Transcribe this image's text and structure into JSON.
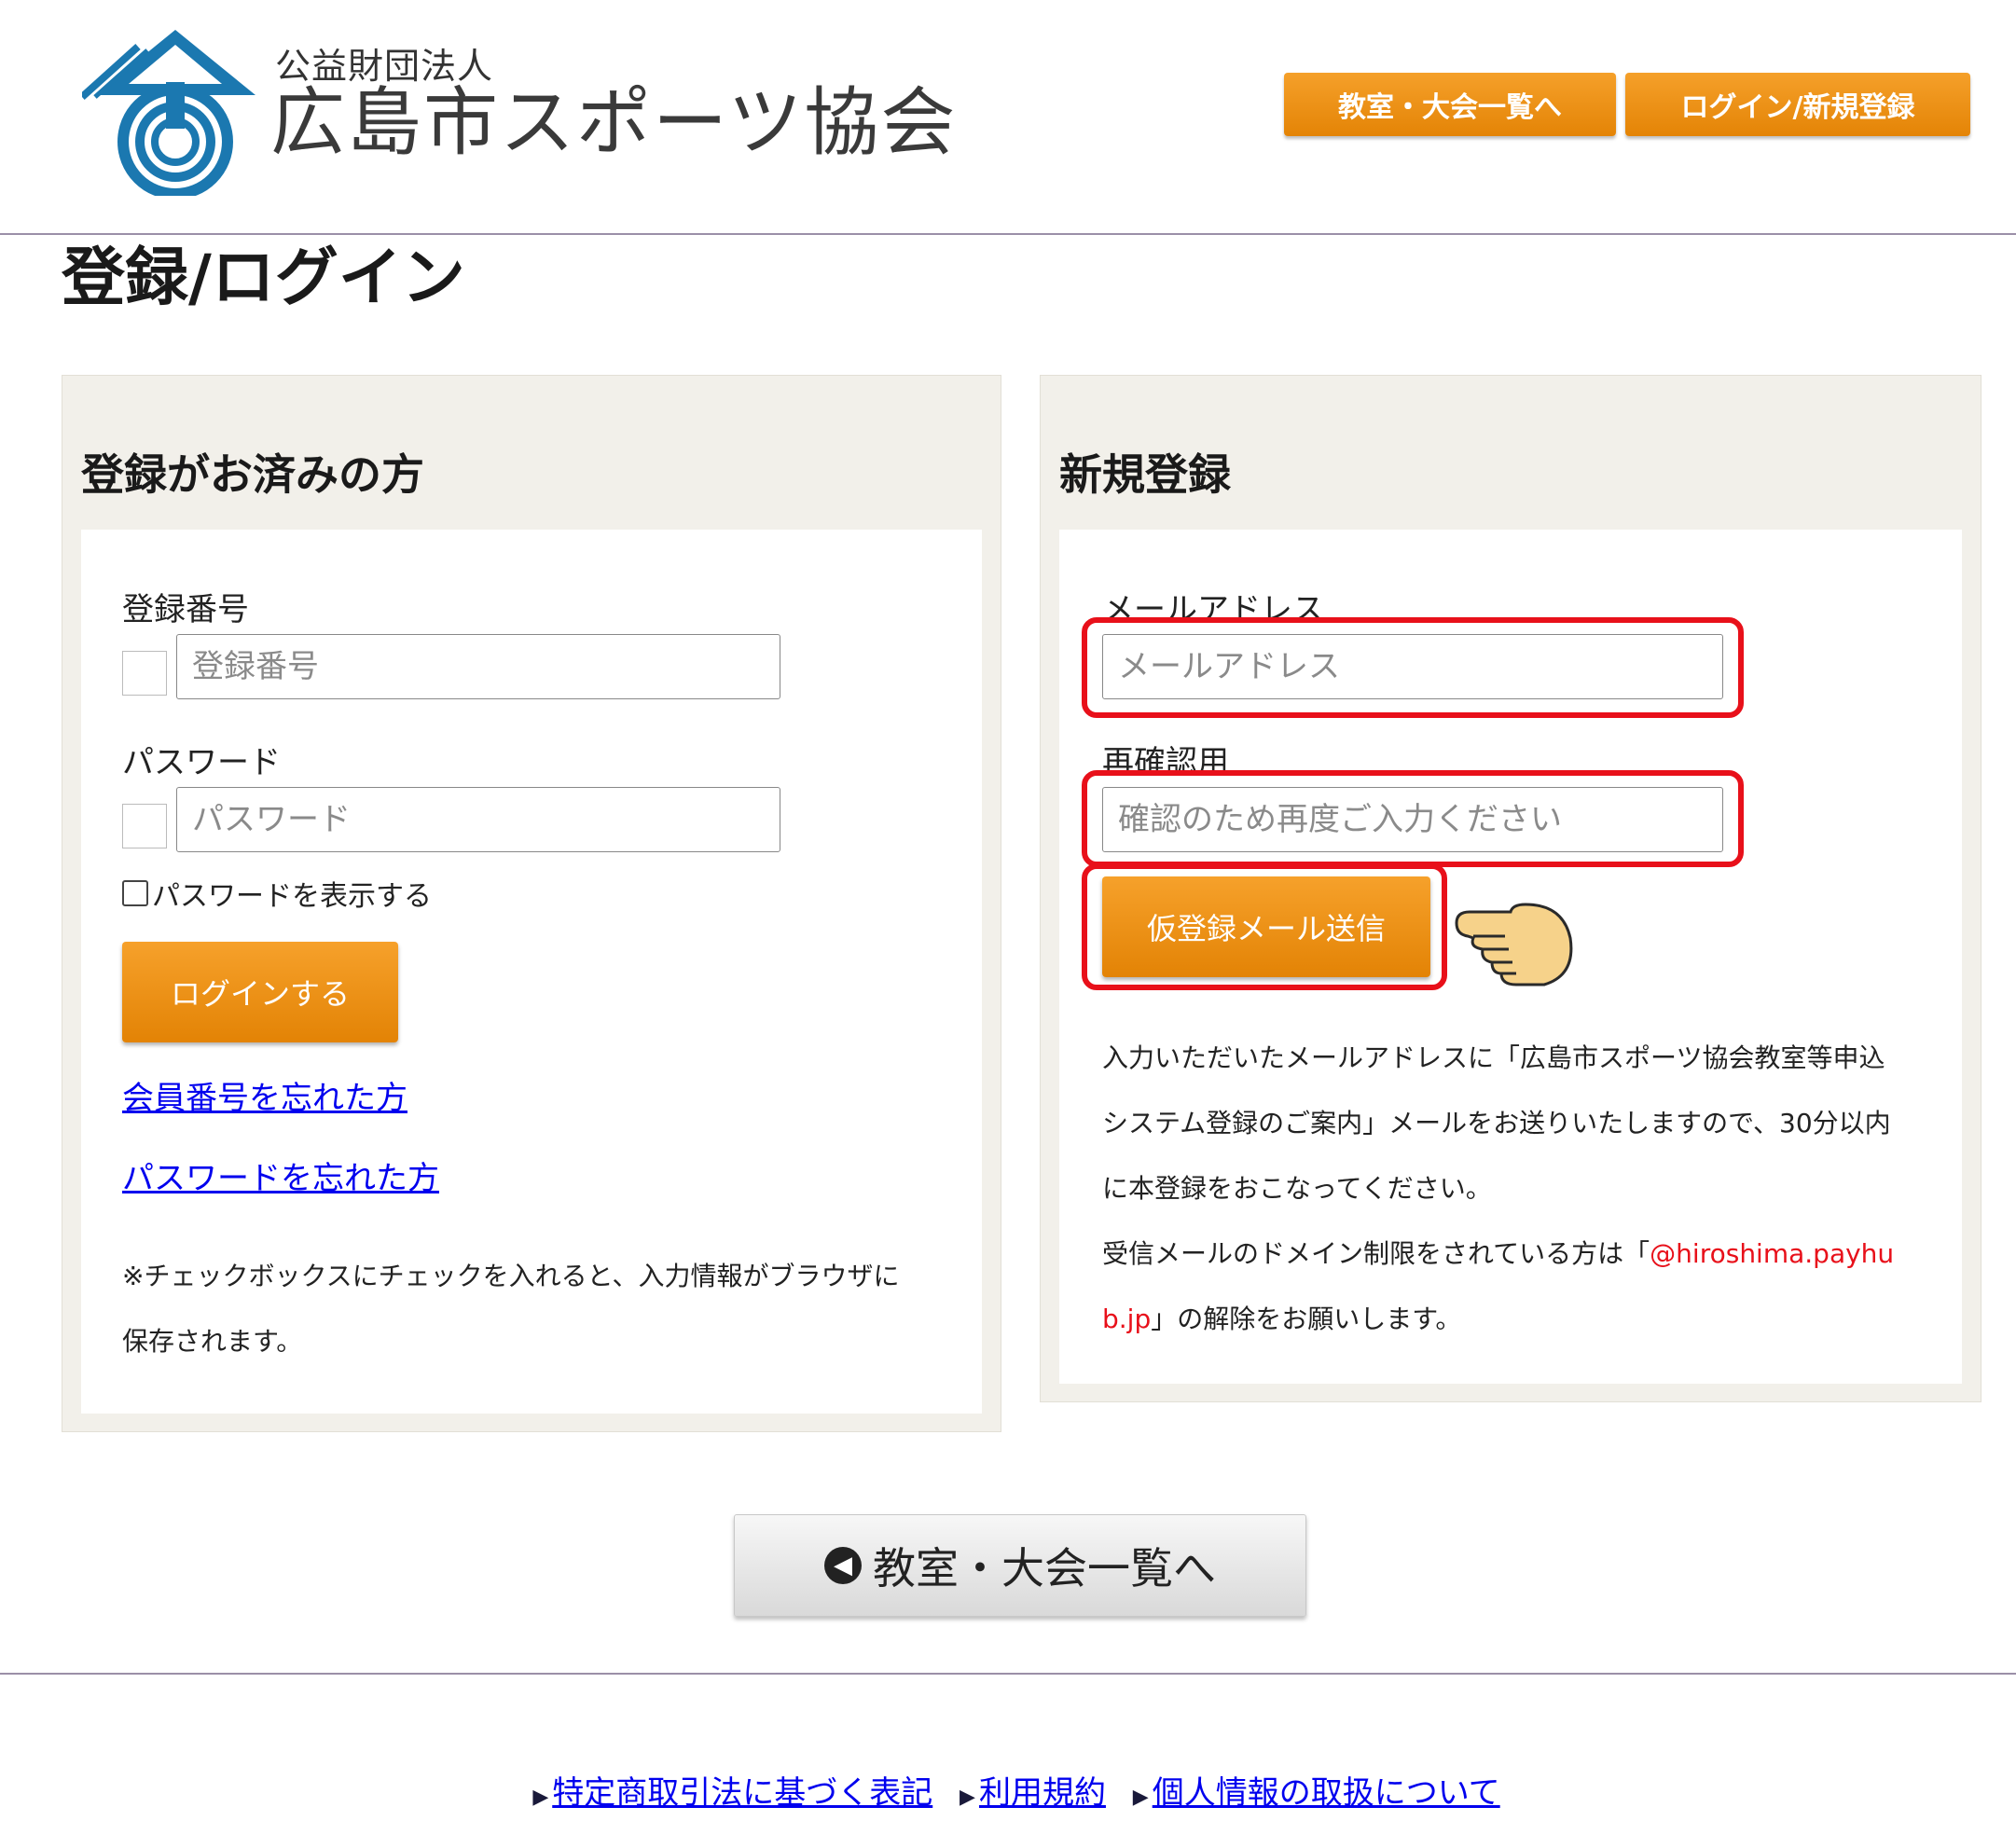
{
  "header": {
    "org_sub": "公益財団法人",
    "org_name": "広島市スポーツ協会",
    "btn_list": "教室・大会一覧へ",
    "btn_login": "ログイン/新規登録"
  },
  "page_title": "登録/ログイン",
  "login_panel": {
    "title": "登録がお済みの方",
    "member_label": "登録番号",
    "member_placeholder": "登録番号",
    "password_label": "パスワード",
    "password_placeholder": "パスワード",
    "show_password_label": "パスワードを表示する",
    "login_button": "ログインする",
    "forgot_member": "会員番号を忘れた方",
    "forgot_password": "パスワードを忘れた方",
    "note_line1": "※チェックボックスにチェックを入れると、入力情報がブラウザに",
    "note_line2": "保存されます。"
  },
  "register_panel": {
    "title": "新規登録",
    "email_label": "メールアドレス",
    "email_placeholder": "メールアドレス",
    "confirm_label": "再確認用",
    "confirm_placeholder": "確認のため再度ご入力ください",
    "send_button": "仮登録メール送信",
    "info_line1": "入力いただいたメールアドレスに「広島市スポーツ協会教室等申込",
    "info_line2": "システム登録のご案内」メールをお送りいたしますので、30分以内",
    "info_line3": "に本登録をおこなってください。",
    "domain_line_prefix": "受信メールのドメイン制限をされている方は「",
    "domain_part1": "@hiroshima.payhu",
    "domain_part2": "b.jp",
    "domain_line_suffix": "」の解除をお願いします。"
  },
  "bottom_button": "教室・大会一覧へ",
  "footer": {
    "link1": "特定商取引法に基づく表記",
    "link2": "利用規約",
    "link3": "個人情報の取扱について"
  },
  "colors": {
    "accent_orange": "#e88a0c",
    "highlight_red": "#e8101a",
    "logo_blue": "#1b78b0",
    "panel_bg": "#f2f0ea"
  }
}
